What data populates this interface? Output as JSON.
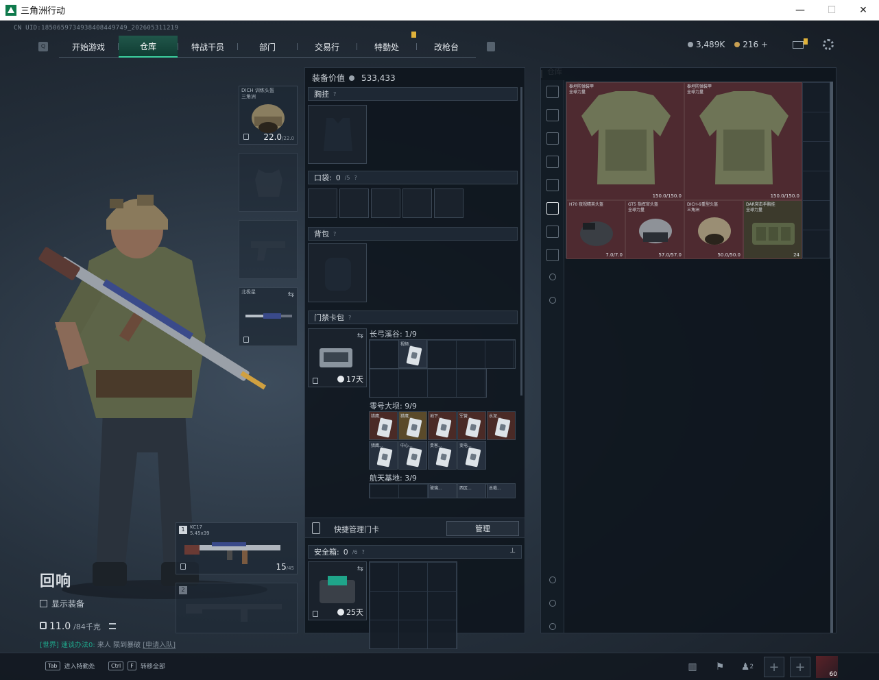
{
  "window": {
    "title": "三角洲行动",
    "minimize": "—",
    "maximize": "☐",
    "close": "✕"
  },
  "uid": "CN UID:18506597349384084497​49_202605311219",
  "nav": {
    "left_key": "Q",
    "tabs": [
      {
        "label": "开始游戏",
        "active": false
      },
      {
        "label": "仓库",
        "active": true
      },
      {
        "label": "特战干员",
        "active": false
      },
      {
        "label": "部门",
        "active": false
      },
      {
        "label": "交易行",
        "active": false
      },
      {
        "label": "特勤处",
        "active": false,
        "badge": true
      },
      {
        "label": "改枪台",
        "active": false
      }
    ]
  },
  "currency": {
    "silver": "3,489K",
    "gold": "216",
    "gold_add": "+"
  },
  "character": {
    "name": "回响",
    "show_gear_label": "显示装备",
    "weight": "11.0",
    "weight_max": "/84千克"
  },
  "chat": {
    "channel": "[世界]",
    "text1": " 速谈办法0: ",
    "text2": "来人 陨到暴破",
    "link": "[申请入队]"
  },
  "equipment": {
    "helmet": {
      "name": "DICH 训练头盔",
      "sub": "三角洲",
      "durability": "22.0",
      "durability_max": "/22.0"
    },
    "melee": {
      "name": "北极星"
    },
    "primary": {
      "slot": "1",
      "name": "KC17",
      "caliber": "5.45x39",
      "ammo": "15",
      "ammo_max": "/45"
    },
    "secondary": {
      "slot": "2"
    }
  },
  "loadout": {
    "equip_value_label": "装备价值",
    "equip_value": "533,433",
    "chest_rig": "胸挂",
    "pockets": "口袋:",
    "pockets_count": "0",
    "pockets_max": "/5",
    "backpack": "背包",
    "keycard_case": "门禁卡包",
    "keycard_days": "17天",
    "map1": "长弓溪谷: 1/9",
    "map2": "零号大坝: 9/9",
    "map3": "航天基地: 3/9",
    "map1_cards": [
      "视频..."
    ],
    "map2_cards": [
      "猎鹰...",
      "猎鹰...",
      "地下...",
      "军营...",
      "水泥...",
      "猎鹰...",
      "中心...",
      "贵客...",
      "变电..."
    ],
    "map3_cards": [
      "玻璃...",
      "西区...",
      "总裁..."
    ],
    "quick_manage": "快捷管理门卡",
    "manage_btn": "管理",
    "safe_box": "安全箱:",
    "safe_count": "0",
    "safe_max": "/6",
    "safe_days": "25天"
  },
  "stash": {
    "title": "仓库",
    "items": [
      {
        "name": "泰坦防弹装甲",
        "sub": "全球力量",
        "value": "150.0/150.0"
      },
      {
        "name": "泰坦防弹装甲",
        "sub": "全球力量",
        "value": "150.0/150.0"
      },
      {
        "name": "H70 夜视精英头盔",
        "sub": "",
        "value": "7.0/7.0"
      },
      {
        "name": "GT5 指挥官头盔",
        "sub": "全球力量",
        "value": "57.0/57.0"
      },
      {
        "name": "DICH-9重型头盔",
        "sub": "三角洲",
        "value": "50.0/50.0"
      },
      {
        "name": "DAR突击手胸挂",
        "sub": "全球力量",
        "value": "24"
      }
    ]
  },
  "bottom": {
    "hint1_key": "Tab",
    "hint1_label": "进入特勤处",
    "hint2_key1": "Ctrl",
    "hint2_key2": "F",
    "hint2_label": "转移全部",
    "squad_count": "2",
    "level": "60"
  }
}
